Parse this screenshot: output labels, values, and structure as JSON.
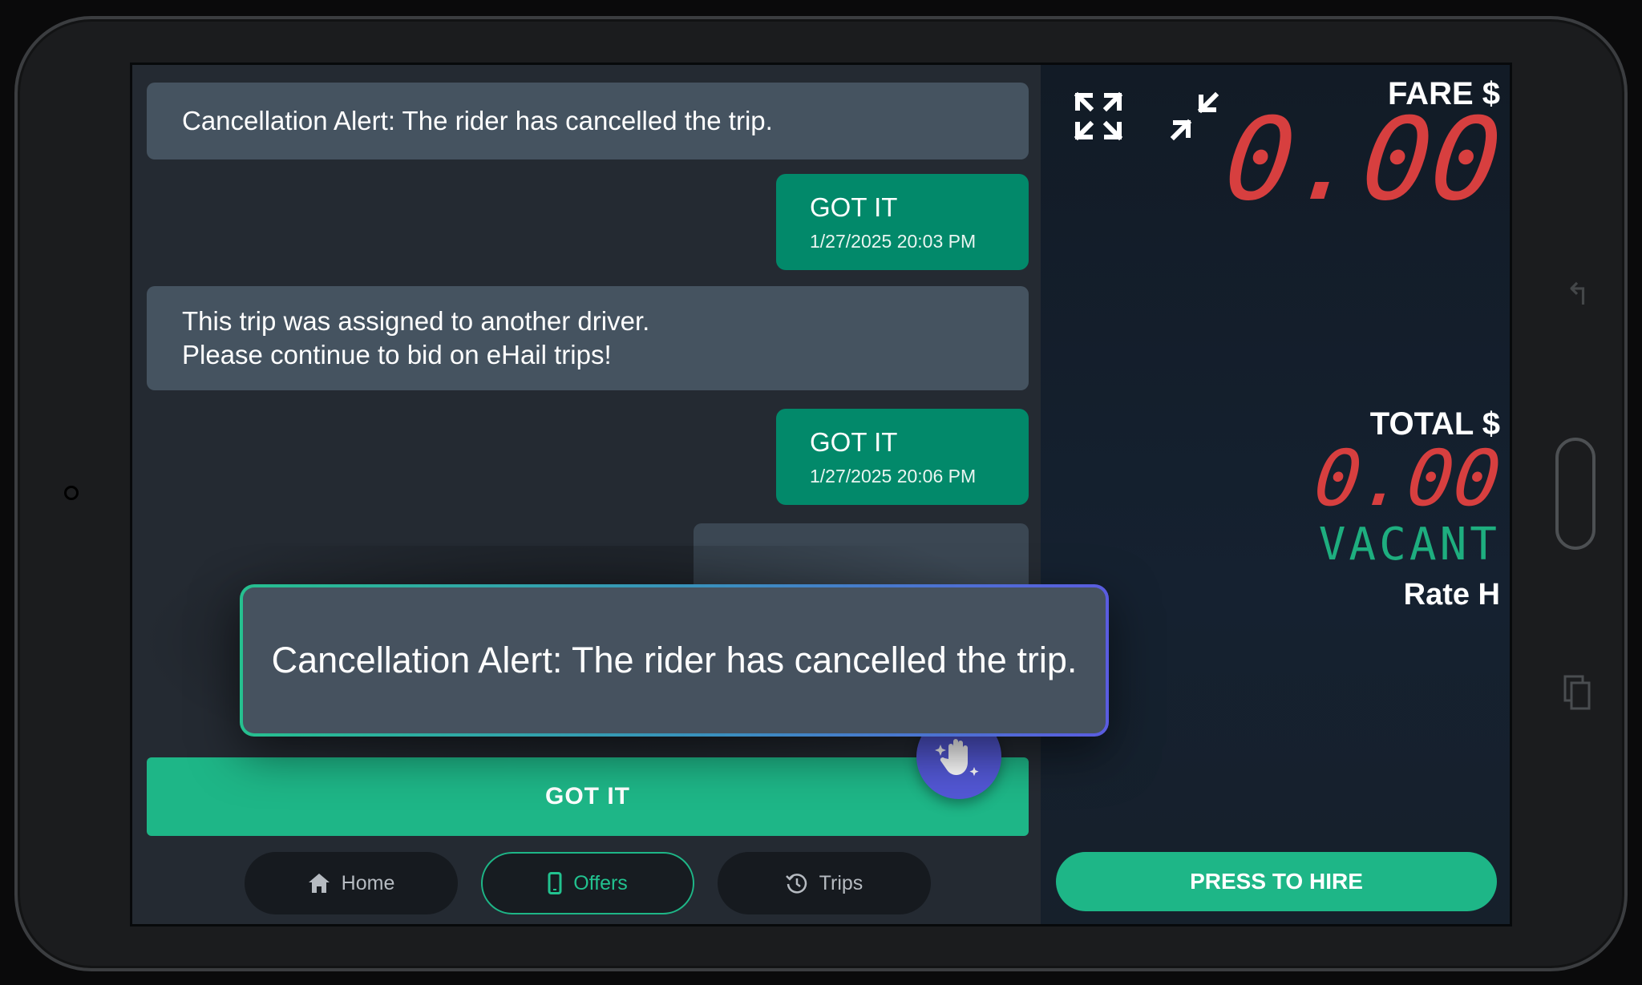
{
  "messages": [
    {
      "type": "alert",
      "lines": [
        "Cancellation Alert: The rider has cancelled the trip."
      ]
    },
    {
      "type": "reply",
      "label": "GOT IT",
      "timestamp": "1/27/2025 20:03 PM"
    },
    {
      "type": "alert",
      "lines": [
        "This trip was assigned to another driver.",
        "Please continue to bid on eHail trips!"
      ]
    },
    {
      "type": "reply",
      "label": "GOT IT",
      "timestamp": "1/27/2025 20:06 PM"
    }
  ],
  "popup": {
    "text": "Cancellation Alert: The rider has cancelled the trip."
  },
  "primary_action": {
    "label": "GOT IT"
  },
  "fab": {
    "icon": "hand-sparkle-icon",
    "color": "#5358d6"
  },
  "nav": [
    {
      "label": "Home",
      "icon": "home-icon",
      "active": false
    },
    {
      "label": "Offers",
      "icon": "phone-icon",
      "active": true
    },
    {
      "label": "Trips",
      "icon": "history-icon",
      "active": false
    }
  ],
  "meter": {
    "fare_label": "FARE $",
    "fare_value": "0.00",
    "total_label": "TOTAL $",
    "total_value": "0.00",
    "status": "VACANT",
    "rate": "Rate H",
    "hire_button": "PRESS TO HIRE",
    "expand_icon": "expand-icon",
    "collapse_icon": "collapse-icon"
  },
  "colors": {
    "accent_green": "#1eb687",
    "reply_green": "#02896a",
    "digit_red": "#d73f3f",
    "alert_bg": "#455360",
    "fab_purple": "#5358d6"
  }
}
